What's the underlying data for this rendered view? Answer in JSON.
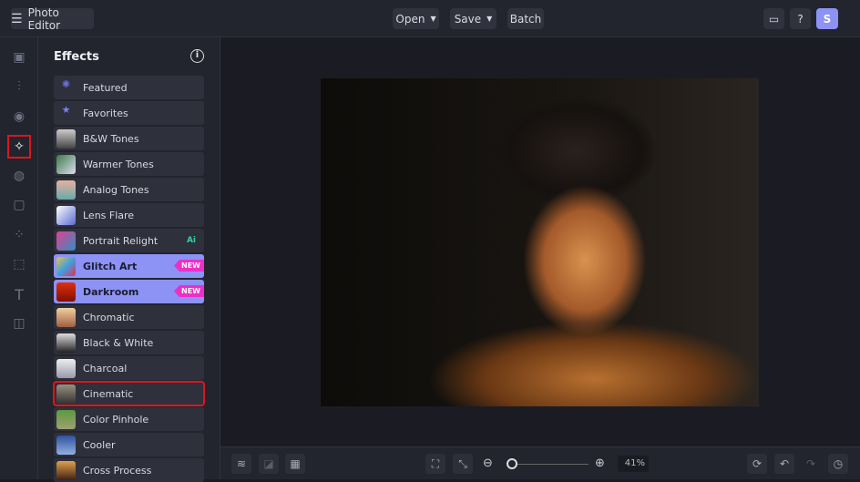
{
  "header": {
    "app_title": "Photo Editor",
    "open_label": "Open",
    "save_label": "Save",
    "batch_label": "Batch",
    "avatar_initial": "S"
  },
  "panel": {
    "title": "Effects",
    "items": [
      {
        "label": "Featured"
      },
      {
        "label": "Favorites"
      },
      {
        "label": "B&W Tones"
      },
      {
        "label": "Warmer Tones"
      },
      {
        "label": "Analog Tones"
      },
      {
        "label": "Lens Flare"
      },
      {
        "label": "Portrait Relight",
        "badge": "Ai"
      },
      {
        "label": "Glitch Art",
        "badge": "NEW"
      },
      {
        "label": "Darkroom",
        "badge": "NEW"
      },
      {
        "label": "Chromatic"
      },
      {
        "label": "Black & White"
      },
      {
        "label": "Charcoal"
      },
      {
        "label": "Cinematic"
      },
      {
        "label": "Color Pinhole"
      },
      {
        "label": "Cooler"
      },
      {
        "label": "Cross Process"
      }
    ]
  },
  "zoom": {
    "value": "41%",
    "fraction": 0.05
  },
  "colors": {
    "accent": "#8d92f5",
    "new_badge": "#ec2fc8",
    "selection": "#e0141c"
  }
}
